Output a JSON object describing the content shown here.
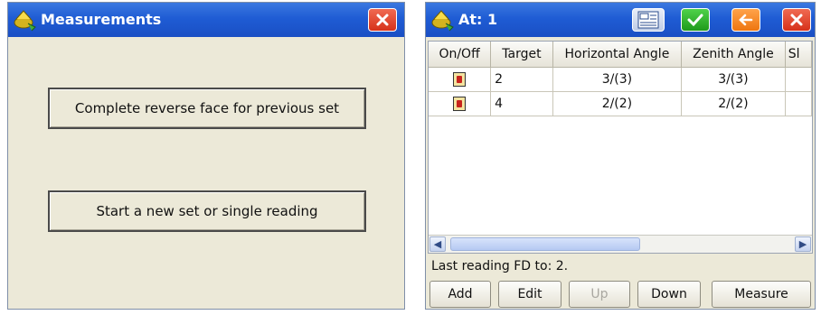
{
  "left_window": {
    "title": "Measurements",
    "buttons": [
      {
        "label": "Complete reverse face for previous set"
      },
      {
        "label": "Start a new set or single reading"
      }
    ]
  },
  "right_window": {
    "title": "At: 1",
    "table": {
      "columns": [
        "On/Off",
        "Target",
        "Horizontal Angle",
        "Zenith Angle",
        "Sl"
      ],
      "rows": [
        {
          "target": "2",
          "horizontal": "3/(3)",
          "zenith": "3/(3)",
          "slope": ""
        },
        {
          "target": "4",
          "horizontal": "2/(2)",
          "zenith": "2/(2)",
          "slope": ""
        }
      ]
    },
    "status": "Last reading FD to: 2.",
    "buttons": {
      "add": "Add",
      "edit": "Edit",
      "up": "Up",
      "down": "Down",
      "measure": "Measure"
    }
  },
  "colors": {
    "titlebar": "#1f5cd4",
    "window_bg": "#ece9d8",
    "close": "#d6311a",
    "ok": "#1f9a1c",
    "back": "#ee7610"
  },
  "icons": [
    "app-icon",
    "close-icon",
    "grid-icon",
    "checkmark-icon",
    "back-arrow-icon",
    "target-icon",
    "scroll-left-icon",
    "scroll-right-icon"
  ]
}
